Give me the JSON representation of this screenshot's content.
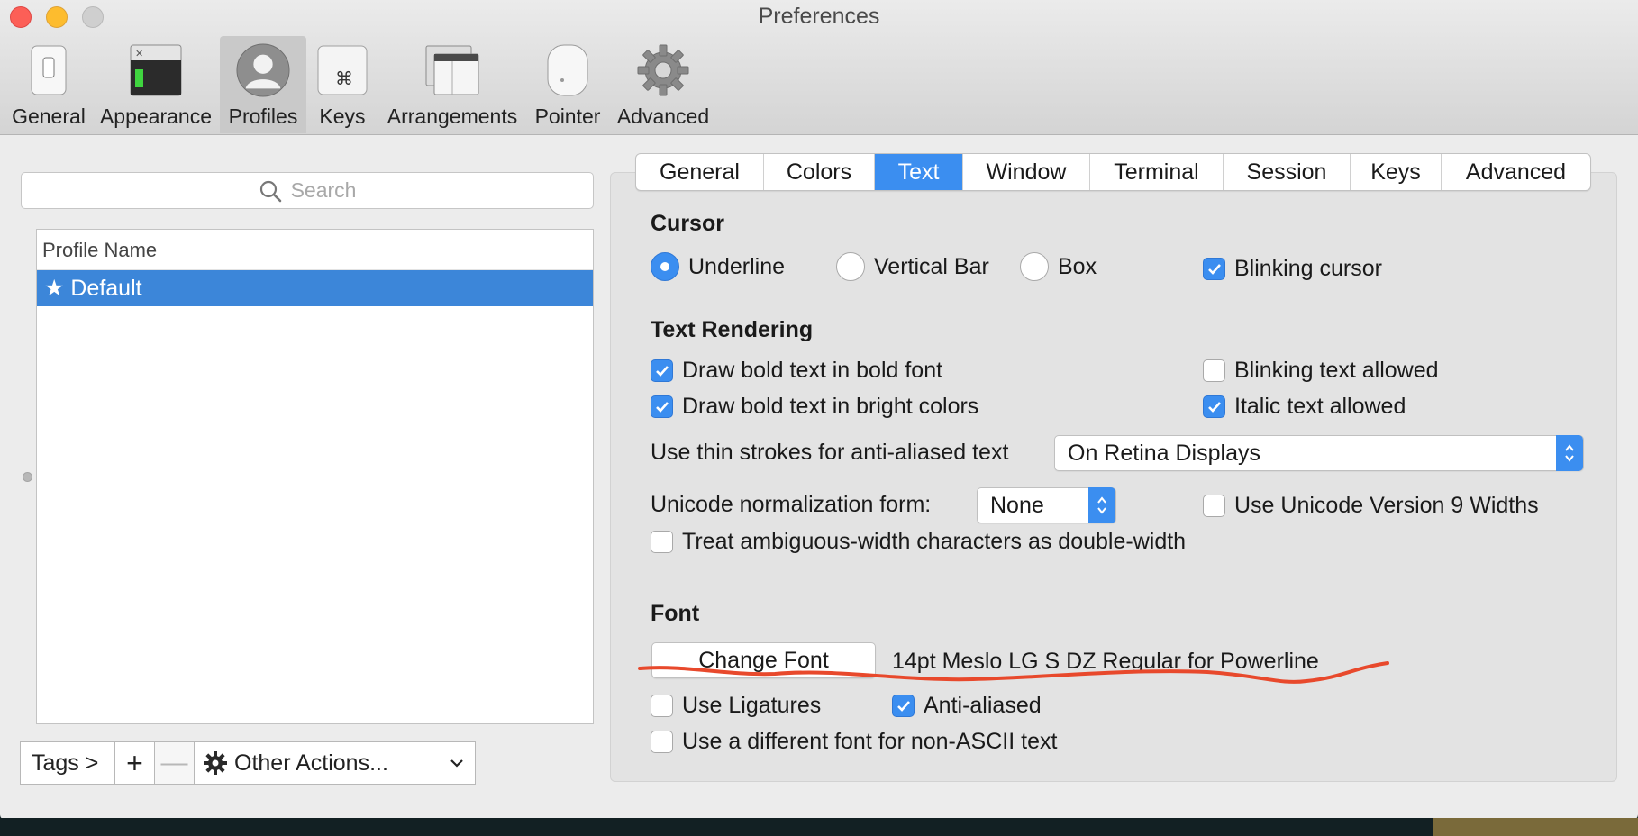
{
  "window": {
    "title": "Preferences"
  },
  "toolbar": {
    "items": [
      {
        "label": "General",
        "icon": "general-switch-icon"
      },
      {
        "label": "Appearance",
        "icon": "appearance-window-icon"
      },
      {
        "label": "Profiles",
        "icon": "profiles-person-icon",
        "selected": true
      },
      {
        "label": "Keys",
        "icon": "keys-command-icon"
      },
      {
        "label": "Arrangements",
        "icon": "arrangements-windows-icon"
      },
      {
        "label": "Pointer",
        "icon": "pointer-mouse-icon"
      },
      {
        "label": "Advanced",
        "icon": "advanced-gear-icon"
      }
    ]
  },
  "left": {
    "search_placeholder": "Search",
    "list_header": "Profile Name",
    "profiles": [
      {
        "name": "★ Default",
        "selected": true
      }
    ],
    "bottom": {
      "tags": "Tags >",
      "add": "+",
      "remove": "—",
      "other": "Other Actions..."
    }
  },
  "tabs": [
    {
      "label": "General"
    },
    {
      "label": "Colors"
    },
    {
      "label": "Text",
      "active": true
    },
    {
      "label": "Window"
    },
    {
      "label": "Terminal"
    },
    {
      "label": "Session"
    },
    {
      "label": "Keys"
    },
    {
      "label": "Advanced"
    }
  ],
  "cursor": {
    "title": "Cursor",
    "underline": "Underline",
    "vertical_bar": "Vertical Bar",
    "box": "Box",
    "selected": "Underline",
    "blinking": {
      "label": "Blinking cursor",
      "checked": true
    }
  },
  "text_rendering": {
    "title": "Text Rendering",
    "bold_font": {
      "label": "Draw bold text in bold font",
      "checked": true
    },
    "bright_colors": {
      "label": "Draw bold text in bright colors",
      "checked": true
    },
    "blinking_text": {
      "label": "Blinking text allowed",
      "checked": false
    },
    "italic_text": {
      "label": "Italic text allowed",
      "checked": true
    },
    "thin_strokes_label": "Use thin strokes for anti-aliased text",
    "thin_strokes_value": "On Retina Displays",
    "unicode_label": "Unicode normalization form:",
    "unicode_value": "None",
    "unicode9": {
      "label": "Use Unicode Version 9 Widths",
      "checked": false
    },
    "ambiguous": {
      "label": "Treat ambiguous-width characters as double-width",
      "checked": false
    }
  },
  "font": {
    "title": "Font",
    "change_button": "Change Font",
    "description": "14pt Meslo LG S DZ Regular for Powerline",
    "ligatures": {
      "label": "Use Ligatures",
      "checked": false
    },
    "anti_aliased": {
      "label": "Anti-aliased",
      "checked": true
    },
    "non_ascii": {
      "label": "Use a different font for non-ASCII text",
      "checked": false
    }
  },
  "colors": {
    "accent": "#3b8ef0",
    "selection": "#3c86d9",
    "annotation": "#e8492c"
  }
}
